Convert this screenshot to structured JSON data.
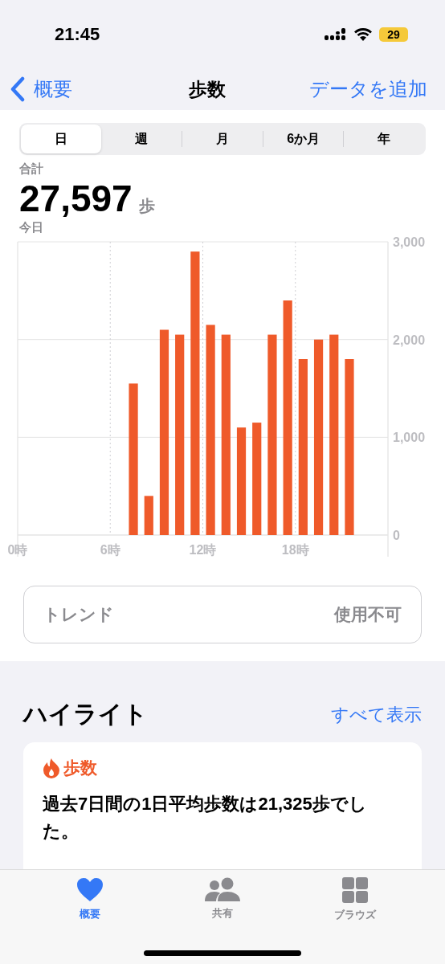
{
  "status_bar": {
    "time": "21:45",
    "battery": "29"
  },
  "nav": {
    "back": "概要",
    "title": "歩数",
    "action": "データを追加"
  },
  "segments": [
    {
      "label": "日",
      "selected": true
    },
    {
      "label": "週",
      "selected": false
    },
    {
      "label": "月",
      "selected": false
    },
    {
      "label": "6か月",
      "selected": false
    },
    {
      "label": "年",
      "selected": false
    }
  ],
  "summary": {
    "label": "合計",
    "value": "27,597",
    "unit": "歩",
    "period": "今日"
  },
  "chart_data": {
    "type": "bar",
    "x": [
      7.5,
      8.5,
      9.5,
      10.5,
      11.5,
      12.5,
      13.5,
      14.5,
      15.5,
      16.5,
      17.5,
      18.5,
      19.5,
      20.5,
      21.5
    ],
    "series": [
      {
        "color": "#ef5a2a",
        "values": [
          1550,
          400,
          2100,
          2050,
          2900,
          2150,
          2050,
          1100,
          1150,
          2050,
          2400,
          1800,
          2000,
          2050,
          1800
        ]
      }
    ],
    "xlim": [
      0,
      24
    ],
    "grid": true,
    "ylim": [
      0,
      3000
    ],
    "xticks": [
      {
        "value": 0,
        "label": "0時"
      },
      {
        "value": 6,
        "label": "6時"
      },
      {
        "value": 12,
        "label": "12時"
      },
      {
        "value": 18,
        "label": "18時"
      }
    ],
    "yticks": [
      {
        "value": 0,
        "label": "0"
      },
      {
        "value": 1000,
        "label": "1,000"
      },
      {
        "value": 2000,
        "label": "2,000"
      },
      {
        "value": 3000,
        "label": "3,000"
      }
    ]
  },
  "trend": {
    "label": "トレンド",
    "value": "使用不可"
  },
  "highlights": {
    "title": "ハイライト",
    "link": "すべて表示",
    "card": {
      "category": "歩数",
      "text": "過去7日間の1日平均歩数は21,325歩でした。"
    }
  },
  "tab_bar": [
    {
      "label": "概要",
      "kind": "heart",
      "selected": true
    },
    {
      "label": "共有",
      "kind": "people",
      "selected": false
    },
    {
      "label": "ブラウズ",
      "kind": "grid",
      "selected": false
    }
  ]
}
